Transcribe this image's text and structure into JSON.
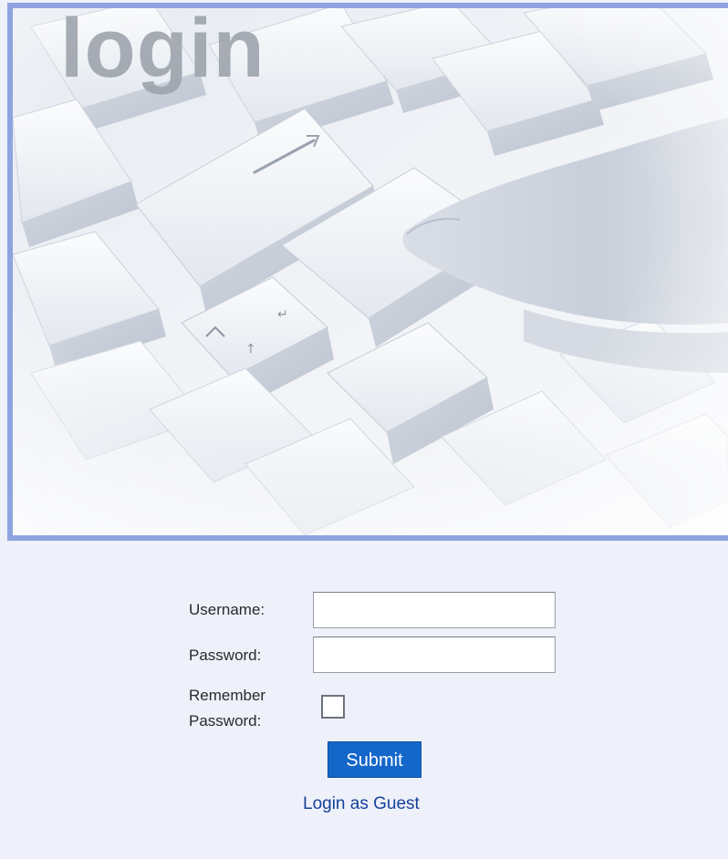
{
  "hero": {
    "title": "login",
    "image_description": "keyboard-photo",
    "border_color": "#8fa3e0"
  },
  "form": {
    "username_label": "Username:",
    "username_value": "",
    "password_label": "Password:",
    "password_value": "",
    "remember_label_line1": "Remember",
    "remember_label_line2": "Password:",
    "remember_checked": false,
    "submit_label": "Submit",
    "guest_link_label": "Login as Guest"
  },
  "colors": {
    "page_background": "#eef1fa",
    "accent_button": "#1467c9",
    "link": "#16409a"
  }
}
